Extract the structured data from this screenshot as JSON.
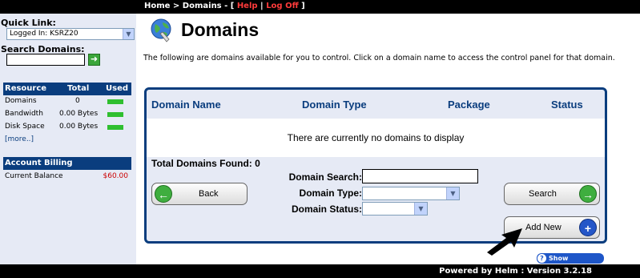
{
  "topbar": {
    "home": "Home",
    "sep1": " > ",
    "domains": "Domains",
    "sep2": " - [ ",
    "help": "Help",
    "pipe": " | ",
    "logoff": "Log Off",
    "close": " ]"
  },
  "sidebar": {
    "quick_link_label": "Quick Link:",
    "quick_link_value": "Logged In: KSRZ20",
    "search_domains_label": "Search Domains:",
    "resource": {
      "headers": [
        "Resource",
        "Total",
        "Used"
      ],
      "rows": [
        {
          "name": "Domains",
          "total": "0"
        },
        {
          "name": "Bandwidth",
          "total": "0.00 Bytes"
        },
        {
          "name": "Disk Space",
          "total": "0.00 Bytes"
        }
      ],
      "more": "[more..]"
    },
    "billing": {
      "header": "Account Billing",
      "balance_label": "Current Balance",
      "balance_value": "$60.00"
    }
  },
  "main": {
    "title": "Domains",
    "description": "The following are domains available for you to control. Click on a domain name to access the control panel for that domain.",
    "table": {
      "headers": [
        "Domain Name",
        "Domain Type",
        "Package",
        "Status"
      ],
      "empty_message": "There are currently no domains to display"
    },
    "total_found": "Total Domains Found: 0",
    "filters": {
      "search_label": "Domain Search:",
      "type_label": "Domain Type:",
      "status_label": "Domain Status:"
    },
    "buttons": {
      "back": "Back",
      "search": "Search",
      "add_new": "Add New"
    },
    "quickhelp": "Show QuickHelp"
  },
  "footer": {
    "text": "Powered by Helm : Version 3.2.18"
  },
  "colors": {
    "navy": "#0a3d7e",
    "sidebar_bg": "#e6eaf5",
    "link_red": "#ff3b3b",
    "usage_green": "#2fbf2f"
  }
}
